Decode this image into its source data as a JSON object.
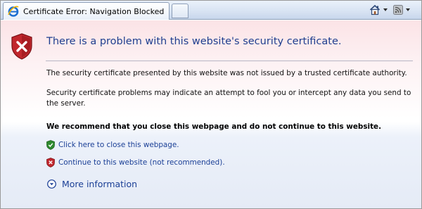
{
  "tab": {
    "title": "Certificate Error: Navigation Blocked",
    "icon": "ie-icon"
  },
  "toolbar": {
    "home_icon": "home-icon",
    "feeds_icon": "feeds-icon"
  },
  "page": {
    "heading": "There is a problem with this website's security certificate.",
    "paragraph_1": "The security certificate presented by this website was not issued by a trusted certificate authority.",
    "paragraph_2": "Security certificate problems may indicate an attempt to fool you or intercept any data you send to the server.",
    "recommendation": "We recommend that you close this webpage and do not continue to this website.",
    "close_link": "Click here to close this webpage.",
    "continue_link": "Continue to this website (not recommended).",
    "more_info": "More information"
  },
  "colors": {
    "heading": "#1f3f8f",
    "link": "#1b3f96",
    "shield_red": "#c1272d",
    "shield_green": "#2f8a2f"
  }
}
